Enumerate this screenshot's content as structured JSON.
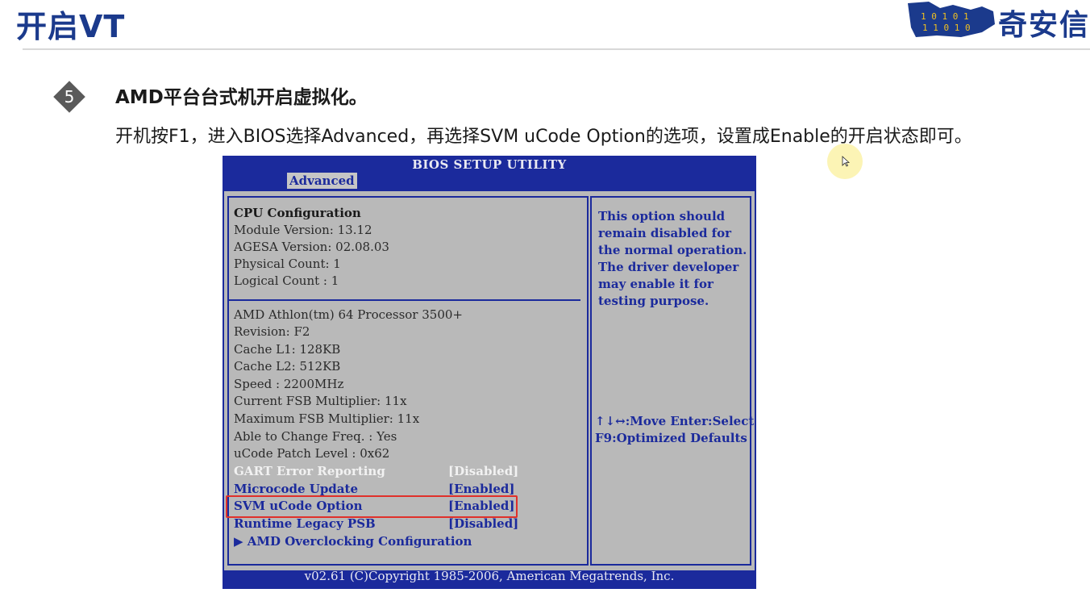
{
  "slide": {
    "title": "开启VT",
    "logo_text": "奇安信",
    "logo_mark": "10101 01010"
  },
  "step": {
    "number": "5",
    "heading": "AMD平台台式机开启虚拟化。",
    "description": "开机按F1，进入BIOS选择Advanced，再选择SVM uCode Option的选项，设置成Enable的开启状态即可。"
  },
  "bios": {
    "title": "BIOS SETUP UTILITY",
    "active_tab": "Advanced",
    "info_lines": [
      "CPU Configuration",
      "Module Version: 13.12",
      "AGESA Version: 02.08.03",
      "Physical Count: 1",
      "Logical Count  : 1"
    ],
    "cpu_lines": [
      "AMD Athlon(tm) 64 Processor 3500+",
      "Revision: F2",
      "Cache L1: 128KB",
      "Cache L2: 512KB",
      "Speed    : 2200MHz",
      "Current FSB Multiplier: 11x",
      "Maximum FSB Multiplier: 11x",
      "Able to Change Freq.   : Yes",
      "uCode Patch Level       : 0x62"
    ],
    "options": [
      {
        "label": "GART Error Reporting",
        "value": "[Disabled]"
      },
      {
        "label": "Microcode Update",
        "value": "[Enabled]"
      },
      {
        "label": "SVM uCode Option",
        "value": "[Enabled]"
      },
      {
        "label": "Runtime Legacy PSB",
        "value": "[Disabled]"
      }
    ],
    "submenu": "▶ AMD Overclocking Configuration",
    "help_lines": [
      "This option should",
      "remain disabled for",
      "the normal operation.",
      "The driver developer",
      "may enable it for",
      "testing purpose."
    ],
    "keys": [
      "↑↓↔:Move   Enter:Select",
      "F9:Optimized Defaults"
    ],
    "footer": "v02.61 (C)Copyright 1985-2006, American Megatrends, Inc."
  },
  "colors": {
    "title_blue": "#1b3a8c",
    "bios_blue": "#1b2a9c",
    "bios_gray": "#b9b9b9",
    "highlight_red": "#e0302a"
  }
}
